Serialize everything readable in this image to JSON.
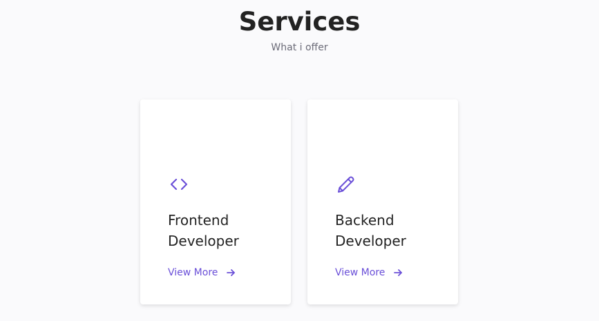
{
  "header": {
    "title": "Services",
    "subtitle": "What i offer"
  },
  "colors": {
    "accent": "#6a4fd8",
    "background": "#fafafc",
    "card": "#ffffff",
    "text": "#222222",
    "muted": "#6b6b78"
  },
  "services": [
    {
      "icon": "code-icon",
      "title_line1": "Frontend",
      "title_line2": "Developer",
      "link_label": "View More"
    },
    {
      "icon": "pencil-icon",
      "title_line1": "Backend",
      "title_line2": "Developer",
      "link_label": "View More"
    }
  ]
}
